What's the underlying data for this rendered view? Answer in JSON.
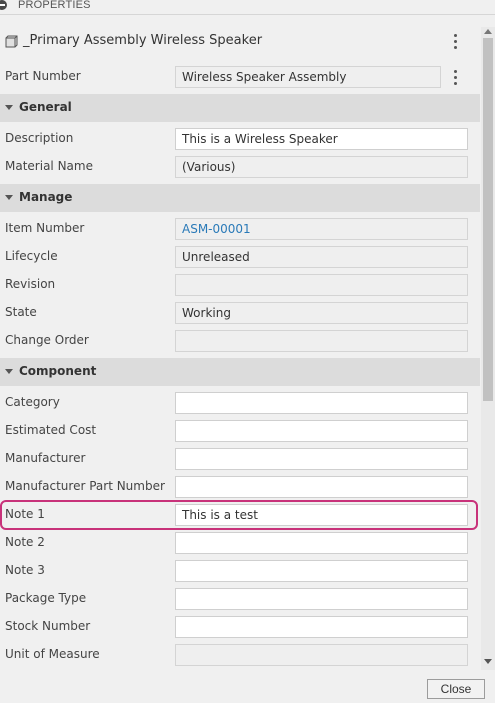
{
  "panel": {
    "title": "PROPERTIES",
    "collapse_icon": "minus-circle-icon"
  },
  "assembly": {
    "icon": "cube-icon",
    "name": "_Primary Assembly Wireless Speaker",
    "menu_icon": "kebab-menu-icon"
  },
  "part_number": {
    "label": "Part Number",
    "value": "Wireless Speaker Assembly",
    "menu_icon": "kebab-menu-icon"
  },
  "sections": {
    "general": {
      "label": "General",
      "rows": [
        {
          "label": "Description",
          "value": "This is a Wireless Speaker"
        },
        {
          "label": "Material Name",
          "value": "(Various)"
        }
      ]
    },
    "manage": {
      "label": "Manage",
      "rows": [
        {
          "label": "Item Number",
          "value": "ASM-00001"
        },
        {
          "label": "Lifecycle",
          "value": "Unreleased"
        },
        {
          "label": "Revision",
          "value": ""
        },
        {
          "label": "State",
          "value": "Working"
        },
        {
          "label": "Change Order",
          "value": ""
        }
      ]
    },
    "component": {
      "label": "Component",
      "rows": [
        {
          "label": "Category",
          "value": ""
        },
        {
          "label": "Estimated Cost",
          "value": ""
        },
        {
          "label": "Manufacturer",
          "value": ""
        },
        {
          "label": "Manufacturer Part Number",
          "value": ""
        },
        {
          "label": "Note 1",
          "value": "This is a test"
        },
        {
          "label": "Note 2",
          "value": ""
        },
        {
          "label": "Note 3",
          "value": ""
        },
        {
          "label": "Package Type",
          "value": ""
        },
        {
          "label": "Stock Number",
          "value": ""
        },
        {
          "label": "Unit of Measure",
          "value": ""
        }
      ]
    }
  },
  "colors": {
    "highlight": "#c8327a",
    "link": "#2a7ab8",
    "section_bg": "#dcdcdc"
  },
  "footer": {
    "close_label": "Close"
  }
}
